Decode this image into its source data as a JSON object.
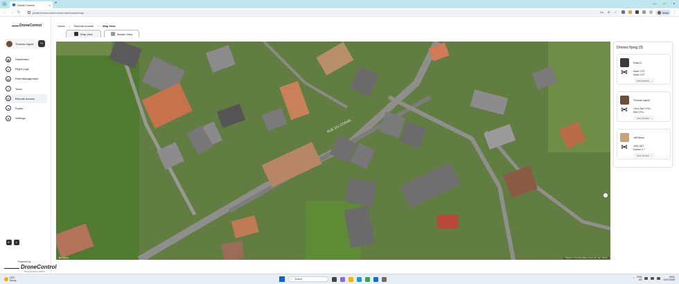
{
  "browser": {
    "tab_title": "Drone Control",
    "tab_close": "×",
    "new_tab": "+",
    "url": "portal.dronecontrol.ch/remoteAccess/map",
    "profile_label": "Work",
    "controls": {
      "minimize": "—",
      "maximize": "□",
      "close": "×"
    }
  },
  "sidebar": {
    "logo_text": "DroneControl",
    "user_name": "Thomas Ingold",
    "nav": [
      {
        "label": "Dashboard",
        "icon": "dashboard-icon",
        "active": false
      },
      {
        "label": "Flight Logs",
        "icon": "flight-logs-icon",
        "active": false
      },
      {
        "label": "Fleet Management",
        "icon": "fleet-icon",
        "active": false
      },
      {
        "label": "Team",
        "icon": "team-icon",
        "active": false
      },
      {
        "label": "Remote Access",
        "icon": "remote-access-icon",
        "active": true
      },
      {
        "label": "Profile",
        "icon": "profile-icon",
        "active": false
      },
      {
        "label": "Settings",
        "icon": "settings-icon",
        "active": false
      }
    ],
    "powered_by": "Powered by",
    "footer_logo": "DroneControl",
    "footer_tagline": "Drone operations platform"
  },
  "breadcrumb": [
    "Home",
    "Remote Access",
    "Map View"
  ],
  "view_tabs": [
    {
      "label": "Map View",
      "active": true
    },
    {
      "label": "Stream View",
      "active": false
    }
  ],
  "map": {
    "street_label": "RUE DU CORAIL",
    "attribution": "© Mapbox © OpenStreetMap Improve this map © Maxar"
  },
  "drones_panel": {
    "title": "Drones flying (3)",
    "cards": [
      {
        "pilot": "Ross D",
        "drone_name": "Mavic 3 ET",
        "drone_model": "Mavic 3 ET",
        "button": "View stream  →",
        "avatar_color": "#3a3a3a"
      },
      {
        "pilot": "Thomas Ingold",
        "drone_name": "Tom's Mini 3 Pro",
        "drone_model": "Mini 3 Pro",
        "button": "View stream  →",
        "avatar_color": "#6e4f36"
      },
      {
        "pilot": "Jeff Stone",
        "drone_name": "Jeff's M4T",
        "drone_model": "Matrice 4 T",
        "button": "View stream  →",
        "avatar_color": "#c7a27a"
      }
    ]
  },
  "taskbar": {
    "weather_temp": "18°C",
    "weather_desc": "Sunny",
    "search_placeholder": "Search",
    "tray_lang": "ENG",
    "tray_region": "US",
    "time": "09:51",
    "date": "22/07/2025"
  }
}
